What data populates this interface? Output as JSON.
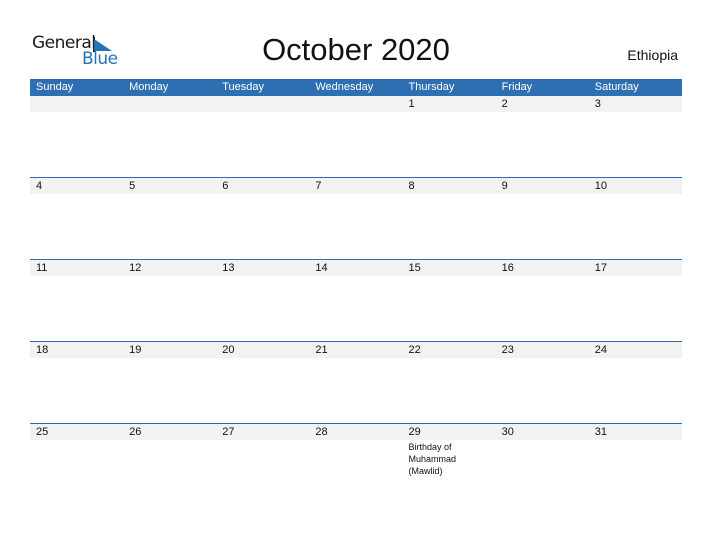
{
  "logo": {
    "word1": "General",
    "word2": "Blue",
    "brand_color": "#2673b8"
  },
  "title": "October 2020",
  "country": "Ethiopia",
  "header_color": "#2e6fb2",
  "weekdays": [
    "Sunday",
    "Monday",
    "Tuesday",
    "Wednesday",
    "Thursday",
    "Friday",
    "Saturday"
  ],
  "weeks": [
    [
      {
        "day": ""
      },
      {
        "day": ""
      },
      {
        "day": ""
      },
      {
        "day": ""
      },
      {
        "day": "1"
      },
      {
        "day": "2"
      },
      {
        "day": "3"
      }
    ],
    [
      {
        "day": "4"
      },
      {
        "day": "5"
      },
      {
        "day": "6"
      },
      {
        "day": "7"
      },
      {
        "day": "8"
      },
      {
        "day": "9"
      },
      {
        "day": "10"
      }
    ],
    [
      {
        "day": "11"
      },
      {
        "day": "12"
      },
      {
        "day": "13"
      },
      {
        "day": "14"
      },
      {
        "day": "15"
      },
      {
        "day": "16"
      },
      {
        "day": "17"
      }
    ],
    [
      {
        "day": "18"
      },
      {
        "day": "19"
      },
      {
        "day": "20"
      },
      {
        "day": "21"
      },
      {
        "day": "22"
      },
      {
        "day": "23"
      },
      {
        "day": "24"
      }
    ],
    [
      {
        "day": "25"
      },
      {
        "day": "26"
      },
      {
        "day": "27"
      },
      {
        "day": "28"
      },
      {
        "day": "29",
        "event": "Birthday of Muhammad (Mawlid)"
      },
      {
        "day": "30"
      },
      {
        "day": "31"
      }
    ]
  ]
}
